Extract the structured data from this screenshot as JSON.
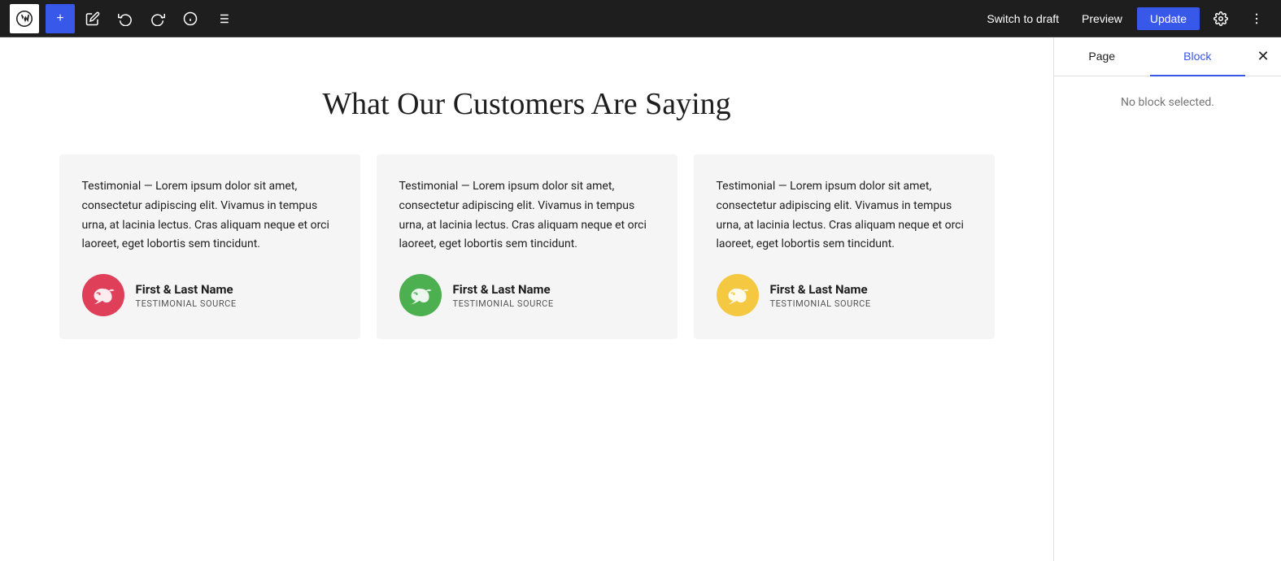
{
  "topbar": {
    "add_label": "+",
    "switch_to_draft_label": "Switch to draft",
    "preview_label": "Preview",
    "update_label": "Update"
  },
  "sidebar": {
    "page_tab_label": "Page",
    "block_tab_label": "Block",
    "active_tab": "block",
    "no_block_selected": "No block selected."
  },
  "section": {
    "title": "What Our Customers Are Saying",
    "testimonials": [
      {
        "text": "Testimonial — Lorem ipsum dolor sit amet, consectetur adipiscing elit. Vivamus in tempus urna, at lacinia lectus. Cras aliquam neque et orci laoreet, eget lobortis sem tincidunt.",
        "author_name": "First & Last Name",
        "author_source": "TESTIMONIAL SOURCE",
        "avatar_color": "#e03f5a"
      },
      {
        "text": "Testimonial — Lorem ipsum dolor sit amet, consectetur adipiscing elit. Vivamus in tempus urna, at lacinia lectus. Cras aliquam neque et orci laoreet, eget lobortis sem tincidunt.",
        "author_name": "First & Last Name",
        "author_source": "TESTIMONIAL SOURCE",
        "avatar_color": "#4caf50"
      },
      {
        "text": "Testimonial — Lorem ipsum dolor sit amet, consectetur adipiscing elit. Vivamus in tempus urna, at lacinia lectus. Cras aliquam neque et orci laoreet, eget lobortis sem tincidunt.",
        "author_name": "First & Last Name",
        "author_source": "TESTIMONIAL SOURCE",
        "avatar_color": "#f5c842"
      }
    ]
  }
}
